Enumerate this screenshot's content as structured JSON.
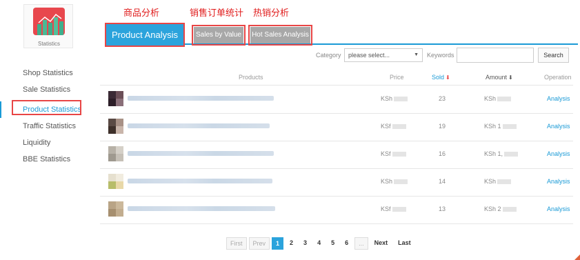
{
  "annotations": [
    "商品分析",
    "销售订单统计",
    "热销分析"
  ],
  "logo": {
    "caption": "Statistics",
    "icon": "chart-bars-icon",
    "color": "#e8474d"
  },
  "sidebar": {
    "items": [
      {
        "label": "Shop Statistics"
      },
      {
        "label": "Sale Statistics"
      },
      {
        "label": "Product Statistics",
        "active": true
      },
      {
        "label": "Traffic Statistics"
      },
      {
        "label": "Liquidity"
      },
      {
        "label": "BBE Statistics"
      }
    ]
  },
  "tabs": {
    "product_analysis": "Product Analysis",
    "sales_by_value": "Sales by Value",
    "hot_sales": "Hot Sales Analysis"
  },
  "filters": {
    "category_label": "Category",
    "category_value": "please select...",
    "keywords_label": "Keywords",
    "keywords_value": "",
    "search_label": "Search"
  },
  "table": {
    "headers": {
      "products": "Products",
      "price": "Price",
      "sold": "Sold",
      "amount": "Amount",
      "operation": "Operation"
    },
    "rows": [
      {
        "price": "KSh",
        "sold": "23",
        "amount": "KSh",
        "operation": "Analysis"
      },
      {
        "price": "KSf",
        "sold": "19",
        "amount": "KSh 1",
        "operation": "Analysis"
      },
      {
        "price": "KSf",
        "sold": "16",
        "amount": "KSh 1,",
        "operation": "Analysis"
      },
      {
        "price": "KSh",
        "sold": "14",
        "amount": "KSh",
        "operation": "Analysis"
      },
      {
        "price": "KSf",
        "sold": "13",
        "amount": "KSh 2",
        "operation": "Analysis"
      }
    ]
  },
  "pagination": {
    "first": "First",
    "prev": "Prev",
    "pages": [
      "1",
      "2",
      "3",
      "4",
      "5",
      "6",
      "..."
    ],
    "next": "Next",
    "last": "Last",
    "current": "1"
  },
  "colors": {
    "accent": "#2ba3dc",
    "highlight": "#e84545",
    "tab_inactive": "#a8a8a8"
  }
}
